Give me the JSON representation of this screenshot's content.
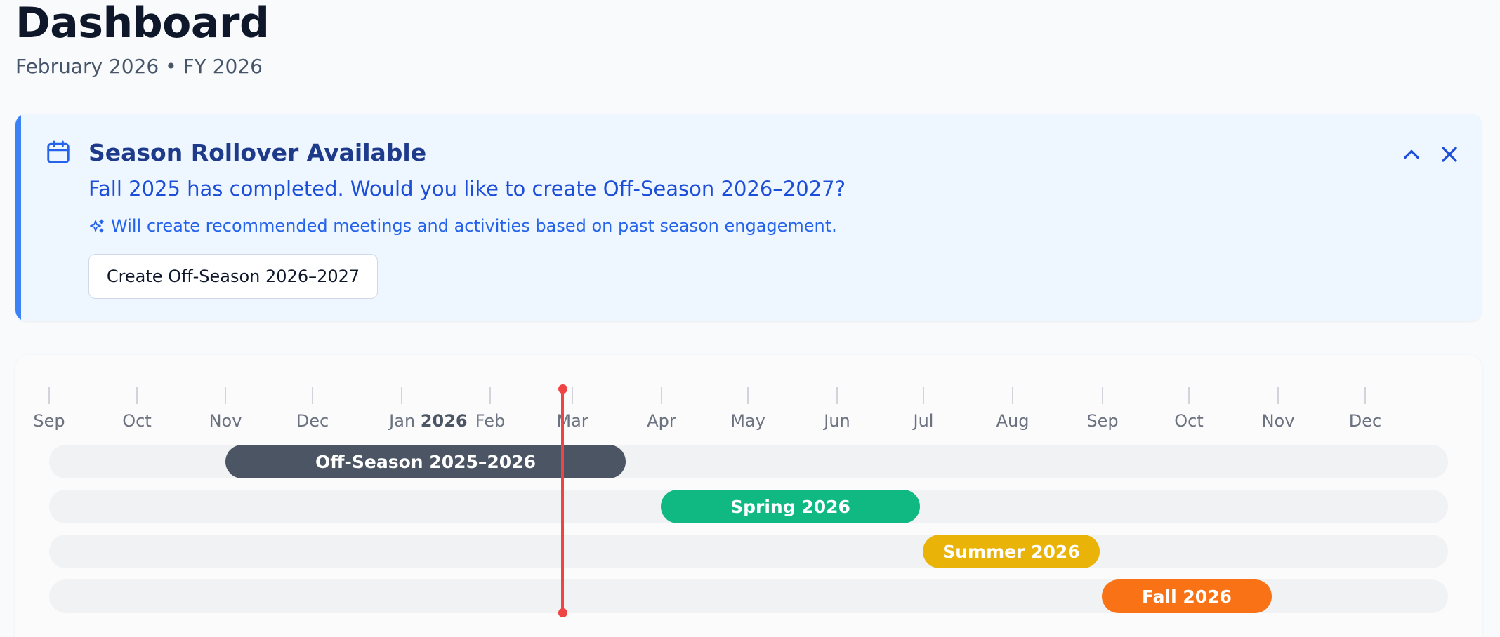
{
  "header": {
    "title": "Dashboard",
    "subtitle": "February 2026 • FY 2026"
  },
  "banner": {
    "icon": "calendar-icon",
    "title": "Season Rollover Available",
    "message": "Fall 2025 has completed. Would you like to create Off-Season 2026–2027?",
    "hint_icon": "sparkles-icon",
    "hint": "Will create recommended meetings and activities based on past season engagement.",
    "action_label": "Create Off-Season 2026–2027",
    "collapse_icon": "chevron-up-icon",
    "close_icon": "close-icon",
    "accent_color": "#3b82f6"
  },
  "timeline": {
    "months": [
      {
        "label": "Sep"
      },
      {
        "label": "Oct"
      },
      {
        "label": "Nov"
      },
      {
        "label": "Dec"
      },
      {
        "label": "Jan",
        "year": "2026"
      },
      {
        "label": "Feb"
      },
      {
        "label": "Mar"
      },
      {
        "label": "Apr"
      },
      {
        "label": "May"
      },
      {
        "label": "Jun"
      },
      {
        "label": "Jul"
      },
      {
        "label": "Aug"
      },
      {
        "label": "Sep"
      },
      {
        "label": "Oct"
      },
      {
        "label": "Nov"
      },
      {
        "label": "Dec"
      }
    ],
    "today_indicator_color": "#ef4444",
    "seasons": [
      {
        "name": "Off-Season 2025–2026",
        "color": "#4b5563"
      },
      {
        "name": "Spring 2026",
        "color": "#10b981"
      },
      {
        "name": "Summer 2026",
        "color": "#eab308"
      },
      {
        "name": "Fall 2026",
        "color": "#f97316"
      }
    ]
  }
}
